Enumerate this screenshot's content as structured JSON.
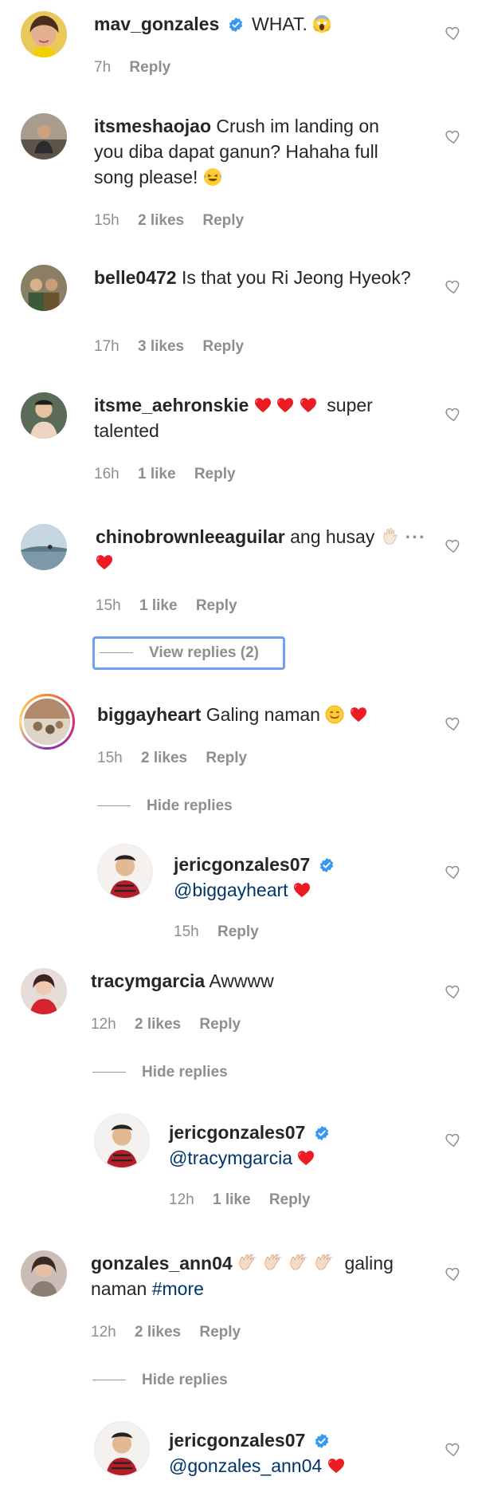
{
  "comments": [
    {
      "user": "mav_gonzales",
      "text": "WHAT.",
      "time": "7h",
      "likes": "",
      "reply": "Reply"
    },
    {
      "user": "itsmeshaojao",
      "text": "Crush im landing on you diba dapat ganun? Hahaha full song please!",
      "time": "15h",
      "likes": "2 likes",
      "reply": "Reply"
    },
    {
      "user": "belle0472",
      "text": "Is that you Ri Jeong Hyeok?",
      "time": "17h",
      "likes": "3 likes",
      "reply": "Reply"
    },
    {
      "user": "itsme_aehronskie",
      "text": "super talented",
      "time": "16h",
      "likes": "1 like",
      "reply": "Reply"
    },
    {
      "user": "chinobrownleeaguilar",
      "text": "ang husay",
      "time": "15h",
      "likes": "1 like",
      "reply": "Reply",
      "view_replies": "View replies (2)"
    },
    {
      "user": "biggayheart",
      "text": "Galing naman",
      "time": "15h",
      "likes": "2 likes",
      "reply": "Reply",
      "hide_replies": "Hide replies"
    },
    {
      "user": "jericgonzales07",
      "mention": "@biggayheart",
      "time": "15h",
      "likes": "",
      "reply": "Reply"
    },
    {
      "user": "tracymgarcia",
      "text": "Awwww",
      "time": "12h",
      "likes": "2 likes",
      "reply": "Reply",
      "hide_replies": "Hide replies"
    },
    {
      "user": "jericgonzales07",
      "mention": "@tracymgarcia",
      "time": "12h",
      "likes": "1 like",
      "reply": "Reply"
    },
    {
      "user": "gonzales_ann04",
      "text": "galing",
      "text2": "naman",
      "hashtag": "#more",
      "time": "12h",
      "likes": "2 likes",
      "reply": "Reply",
      "hide_replies": "Hide replies"
    },
    {
      "user": "jericgonzales07",
      "mention": "@gonzales_ann04"
    }
  ],
  "colors": {
    "verified": "#3897f0",
    "heart_red": "#ed1c24",
    "meta_gray": "#8e8e8e",
    "link": "#003569",
    "focus_outline": "#6da0f0"
  },
  "icons": {
    "like": "heart-outline-icon",
    "verified": "verified-badge-icon"
  }
}
